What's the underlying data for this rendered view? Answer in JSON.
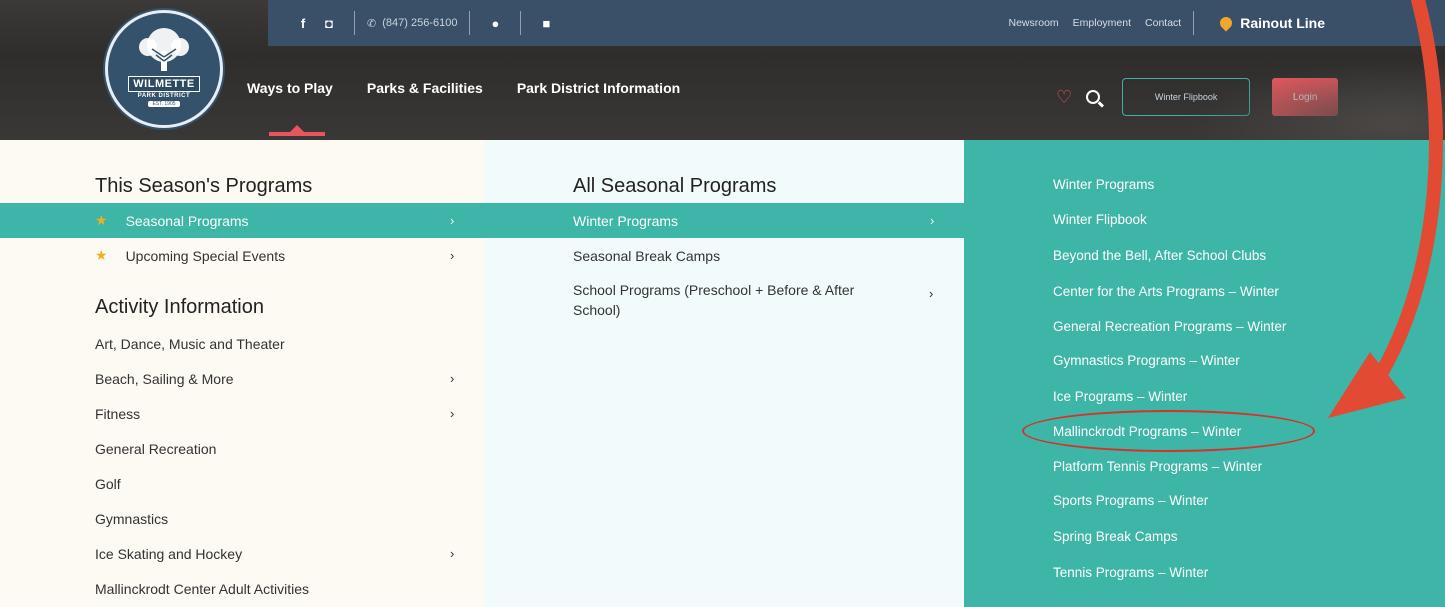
{
  "topbar": {
    "facebook_icon": "f",
    "instagram_icon": "◘",
    "phone": "(847) 256-6100",
    "links": [
      "Newsroom",
      "Employment",
      "Contact"
    ],
    "rainout": "Rainout Line"
  },
  "logo": {
    "name": "WILMETTE",
    "sub": "PARK DISTRICT",
    "est": "EST. 1905"
  },
  "nav": {
    "items": [
      "Ways to Play",
      "Parks & Facilities",
      "Park District Information"
    ]
  },
  "header_actions": {
    "flipbook": "Winter Flipbook",
    "login": "Login"
  },
  "col1": {
    "heading1": "This Season's Programs",
    "season_items": [
      "Seasonal Programs",
      "Upcoming Special Events"
    ],
    "heading2": "Activity Information",
    "activity_items": [
      "Art, Dance, Music and Theater",
      "Beach, Sailing & More",
      "Fitness",
      "General Recreation",
      "Golf",
      "Gymnastics",
      "Ice Skating and Hockey",
      "Mallinckrodt Center Adult Activities"
    ]
  },
  "col2": {
    "heading": "All Seasonal Programs",
    "items": [
      "Winter Programs",
      "Seasonal Break Camps",
      "School Programs (Preschool + Before & After School)"
    ]
  },
  "col3": {
    "items": [
      "Winter Programs",
      "Winter Flipbook",
      "Beyond the Bell, After School Clubs",
      "Center for the Arts Programs – Winter",
      "General Recreation Programs – Winter",
      "Gymnastics Programs – Winter",
      "Ice Programs – Winter",
      "Mallinckrodt Programs – Winter",
      "Platform Tennis Programs – Winter",
      "Sports Programs – Winter",
      "Spring Break Camps",
      "Tennis Programs – Winter"
    ]
  },
  "colors": {
    "accent_teal": "#3db5a7",
    "accent_red": "#ea5960",
    "topbar_blue": "#3a5068",
    "annotation_red": "#e24a33"
  }
}
